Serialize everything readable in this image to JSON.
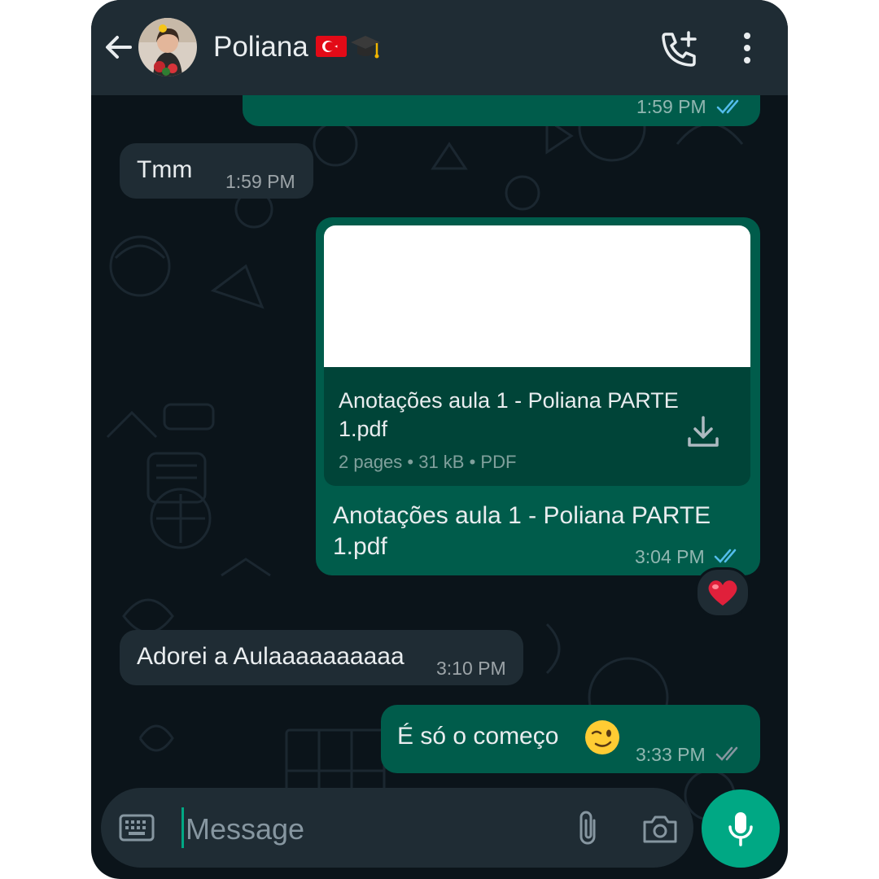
{
  "header": {
    "contact_name": "Poliana",
    "icons": [
      "back-arrow-icon",
      "avatar",
      "turkey-flag-emoji",
      "graduation-cap-emoji",
      "add-call-icon",
      "more-vert-icon"
    ]
  },
  "messages": [
    {
      "direction": "out",
      "time": "1:59 PM",
      "status": "read"
    },
    {
      "direction": "in",
      "text": "Tmm",
      "time": "1:59 PM"
    },
    {
      "direction": "out",
      "type": "document",
      "doc_name": "Anotações aula 1 - Poliana PARTE 1.pdf",
      "doc_meta": "2 pages • 31 kB • PDF",
      "caption_line1": "Anotações aula 1 - Poliana PARTE",
      "caption_line2": "1.pdf",
      "time": "3:04 PM",
      "status": "read",
      "reaction": "red-heart-emoji"
    },
    {
      "direction": "in",
      "text": "Adorei a Aulaaaaaaaaaa",
      "time": "3:10 PM"
    },
    {
      "direction": "out",
      "text": "É só o começo",
      "emoji": "winking-face-emoji",
      "time": "3:33 PM",
      "status": "delivered"
    }
  ],
  "input": {
    "placeholder": "Message",
    "icons": [
      "keyboard-icon",
      "attach-icon",
      "camera-icon",
      "mic-icon"
    ]
  },
  "colors": {
    "background": "#0b141a",
    "header": "#1f2c34",
    "outgoing_bubble": "#005c4b",
    "incoming_bubble": "#1f2c34",
    "accent": "#00a884",
    "read_ticks": "#53bdeb",
    "text": "#e9edef"
  }
}
